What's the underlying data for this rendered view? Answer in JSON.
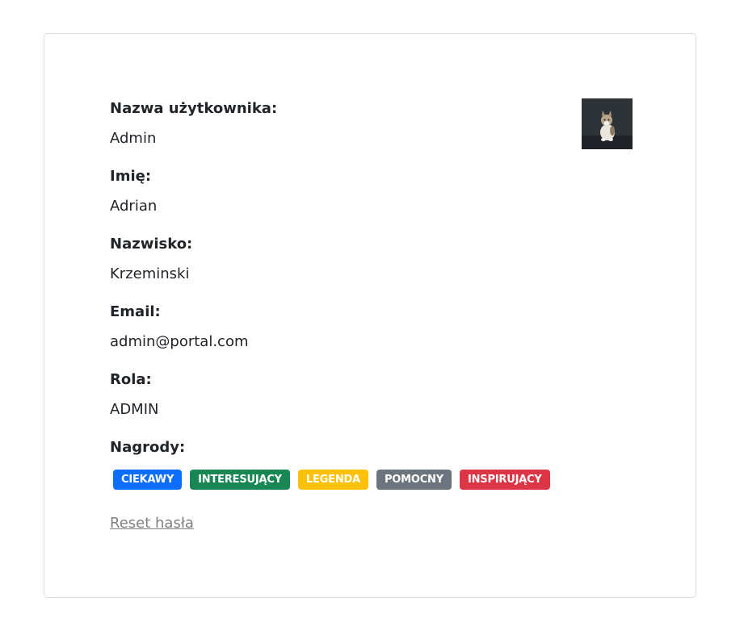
{
  "profile": {
    "fields": [
      {
        "label": "Nazwa użytkownika:",
        "value": "Admin"
      },
      {
        "label": "Imię:",
        "value": "Adrian"
      },
      {
        "label": "Nazwisko:",
        "value": "Krzeminski"
      },
      {
        "label": "Email:",
        "value": "admin@portal.com"
      },
      {
        "label": "Rola:",
        "value": "ADMIN"
      }
    ],
    "awards_label": "Nagrody:",
    "badges": [
      {
        "label": "CIEKAWY",
        "color": "#0d6efd"
      },
      {
        "label": "INTERESUJĄCY",
        "color": "#198754"
      },
      {
        "label": "LEGENDA",
        "color": "#ffc107"
      },
      {
        "label": "POMOCNY",
        "color": "#6c757d"
      },
      {
        "label": "INSPIRUJĄCY",
        "color": "#dc3545"
      }
    ],
    "reset_password_label": "Reset hasła",
    "avatar_icon": "cat-photo-icon"
  }
}
